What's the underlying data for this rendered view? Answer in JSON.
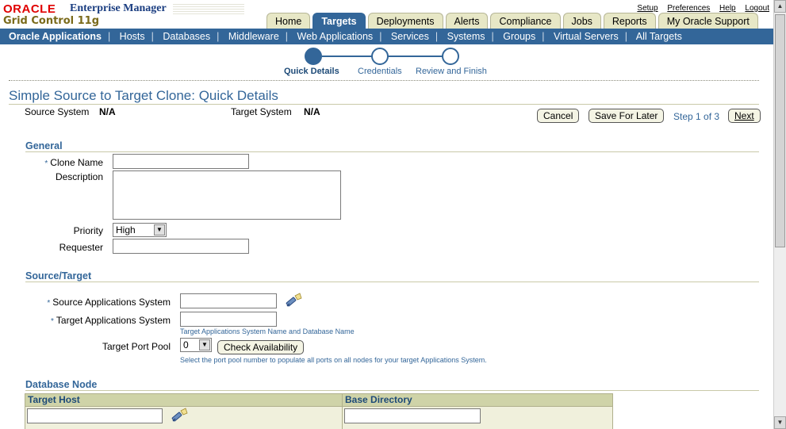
{
  "header": {
    "brand_oracle": "ORACLE",
    "brand_product": "Enterprise Manager",
    "brand_edition": "Grid Control 11g",
    "global_links": [
      "Setup",
      "Preferences",
      "Help",
      "Logout"
    ]
  },
  "tabs": [
    "Home",
    "Targets",
    "Deployments",
    "Alerts",
    "Compliance",
    "Jobs",
    "Reports",
    "My Oracle Support"
  ],
  "active_tab": "Targets",
  "subnav": [
    "Oracle Applications",
    "Hosts",
    "Databases",
    "Middleware",
    "Web Applications",
    "Services",
    "Systems",
    "Groups",
    "Virtual Servers",
    "All Targets"
  ],
  "active_subnav": "Oracle Applications",
  "train": {
    "steps": [
      "Quick Details",
      "Credentials",
      "Review and Finish"
    ],
    "current_step_index": 0
  },
  "page": {
    "title": "Simple Source to Target Clone: Quick Details",
    "source_system_label": "Source System",
    "source_system_value": "N/A",
    "target_system_label": "Target System",
    "target_system_value": "N/A",
    "cancel_label": "Cancel",
    "save_label": "Save For Later",
    "step_text": "Step 1 of 3",
    "next_label": "Next"
  },
  "general": {
    "heading": "General",
    "required_marker": "*",
    "clone_name_label": "Clone Name",
    "clone_name_value": "",
    "description_label": "Description",
    "description_value": "",
    "priority_label": "Priority",
    "priority_value": "High",
    "requester_label": "Requester",
    "requester_value": ""
  },
  "source_target": {
    "heading": "Source/Target",
    "source_label": "Source Applications System",
    "source_value": "",
    "target_label": "Target Applications System",
    "target_value": "",
    "target_hint": "Target Applications System Name and Database Name",
    "port_pool_label": "Target Port Pool",
    "port_pool_value": "0",
    "check_label": "Check Availability",
    "port_hint": "Select the port pool number to populate all ports on all nodes for your target Applications System."
  },
  "database_node": {
    "heading": "Database Node",
    "columns": [
      "Target Host",
      "Base Directory"
    ],
    "target_host_value": "",
    "base_directory_value": ""
  },
  "colors": {
    "accent": "#336699",
    "tab_bg": "#e7e7c6",
    "table_header": "#cfd3a8",
    "brand_red": "#e00000"
  },
  "icons": {
    "flashlight": "flashlight-search-icon"
  }
}
